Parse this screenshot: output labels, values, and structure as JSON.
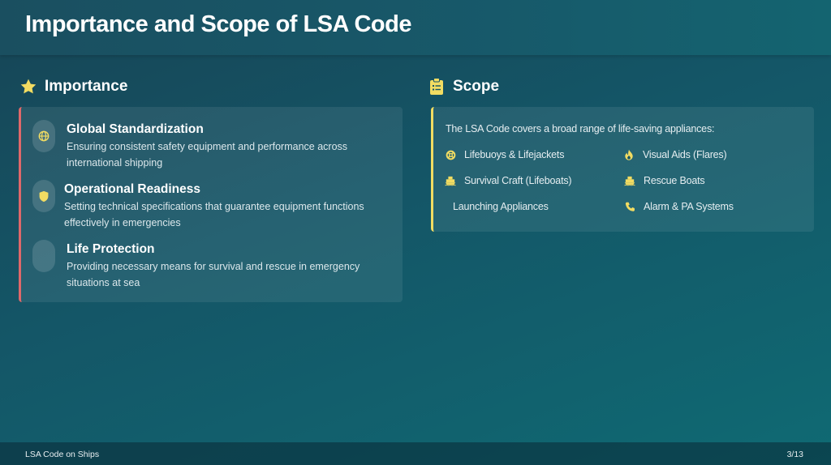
{
  "slide": {
    "title": "Importance and Scope of LSA Code"
  },
  "importance": {
    "heading": "Importance",
    "icon": "star-icon",
    "accent": "#e0686a",
    "items": [
      {
        "title": "Global Standardization",
        "description": "Ensuring consistent safety equipment and performance across international shipping",
        "icon": "globe-icon"
      },
      {
        "title": "Operational Readiness",
        "description": "Setting technical specifications that guarantee equipment functions effectively in emergencies",
        "icon": "shield-icon"
      },
      {
        "title": "Life Protection",
        "description": "Providing necessary means for survival and rescue in emergency situations at sea",
        "icon": "life-icon"
      }
    ]
  },
  "scope": {
    "heading": "Scope",
    "icon": "clipboard-icon",
    "accent": "#f2dc62",
    "intro": "The LSA Code covers a broad range of life-saving appliances:",
    "items": [
      {
        "label": "Lifebuoys & Lifejackets",
        "icon": "lifebuoy-icon"
      },
      {
        "label": "Visual Aids (Flares)",
        "icon": "fire-icon"
      },
      {
        "label": "Survival Craft (Lifeboats)",
        "icon": "ship-icon"
      },
      {
        "label": "Rescue Boats",
        "icon": "ship-icon"
      },
      {
        "label": "Launching Appliances",
        "icon": ""
      },
      {
        "label": "Alarm & PA Systems",
        "icon": "phone-icon"
      }
    ]
  },
  "footer": {
    "left": "LSA Code on Ships",
    "page": "3/13"
  },
  "colors": {
    "icon_yellow": "#f2dc62",
    "left_accent": "#e0686a"
  }
}
